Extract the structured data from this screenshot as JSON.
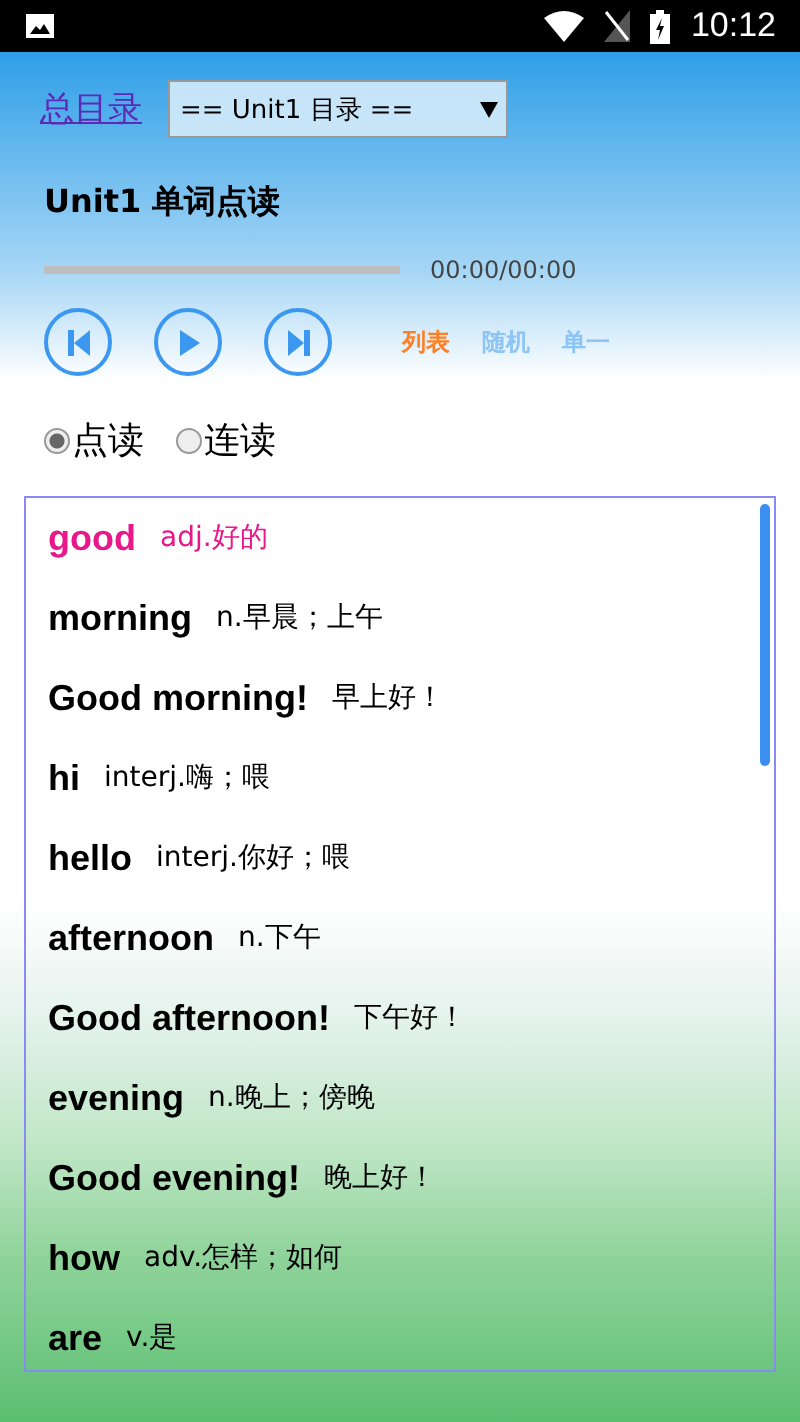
{
  "status_bar": {
    "time": "10:12"
  },
  "header": {
    "catalog_link": "总目录",
    "unit_select": {
      "value": "== Unit1 目录 =="
    }
  },
  "title": "Unit1 单词点读",
  "player": {
    "level": 0,
    "time": "00:00/00:00"
  },
  "play_modes": [
    {
      "label": "列表",
      "selected": true
    },
    {
      "label": "随机",
      "selected": false
    },
    {
      "label": "单一",
      "selected": false
    }
  ],
  "read_modes": [
    {
      "label": "点读",
      "selected": true
    },
    {
      "label": "连读",
      "selected": false
    }
  ],
  "words": [
    {
      "word": "good",
      "meaning": "adj.好的",
      "selected": true
    },
    {
      "word": "morning",
      "meaning": "n.早晨；上午",
      "selected": false
    },
    {
      "word": "Good morning!",
      "meaning": "早上好！",
      "selected": false
    },
    {
      "word": "hi",
      "meaning": "interj.嗨；喂",
      "selected": false
    },
    {
      "word": "hello",
      "meaning": "interj.你好；喂",
      "selected": false
    },
    {
      "word": "afternoon",
      "meaning": "n.下午",
      "selected": false
    },
    {
      "word": "Good afternoon!",
      "meaning": "下午好！",
      "selected": false
    },
    {
      "word": "evening",
      "meaning": "n.晚上；傍晚",
      "selected": false
    },
    {
      "word": "Good evening!",
      "meaning": "晚上好！",
      "selected": false
    },
    {
      "word": "how",
      "meaning": "adv.怎样；如何",
      "selected": false
    },
    {
      "word": "are",
      "meaning": "v.是",
      "selected": false
    }
  ]
}
